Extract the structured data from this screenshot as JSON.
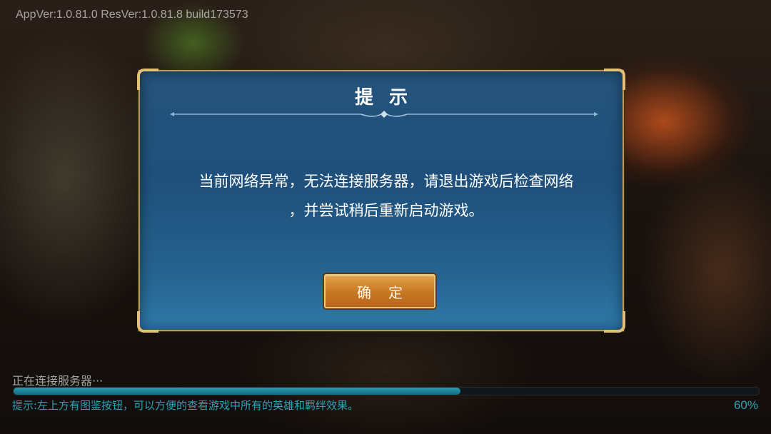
{
  "header": {
    "version_text": "AppVer:1.0.81.0  ResVer:1.0.81.8  build173573"
  },
  "dialog": {
    "title": "提示",
    "message_line1": "当前网络异常，无法连接服务器，请退出游戏后检查网络",
    "message_line2": "，并尝试稍后重新启动游戏。",
    "confirm_label": "确定"
  },
  "loading": {
    "status": "正在连接服务器···",
    "progress": 0.6,
    "percent_label": "60%",
    "tip": "提示:左上方有图鉴按钮，可以方便的查看游戏中所有的英雄和羁绊效果。"
  },
  "colors": {
    "accent_teal": "#2aa3b8",
    "button_gold": "#c97a24",
    "dialog_blue": "#1f517c",
    "frame_gold": "#e2c07a"
  },
  "icons": [
    "ornament-divider-icon"
  ]
}
